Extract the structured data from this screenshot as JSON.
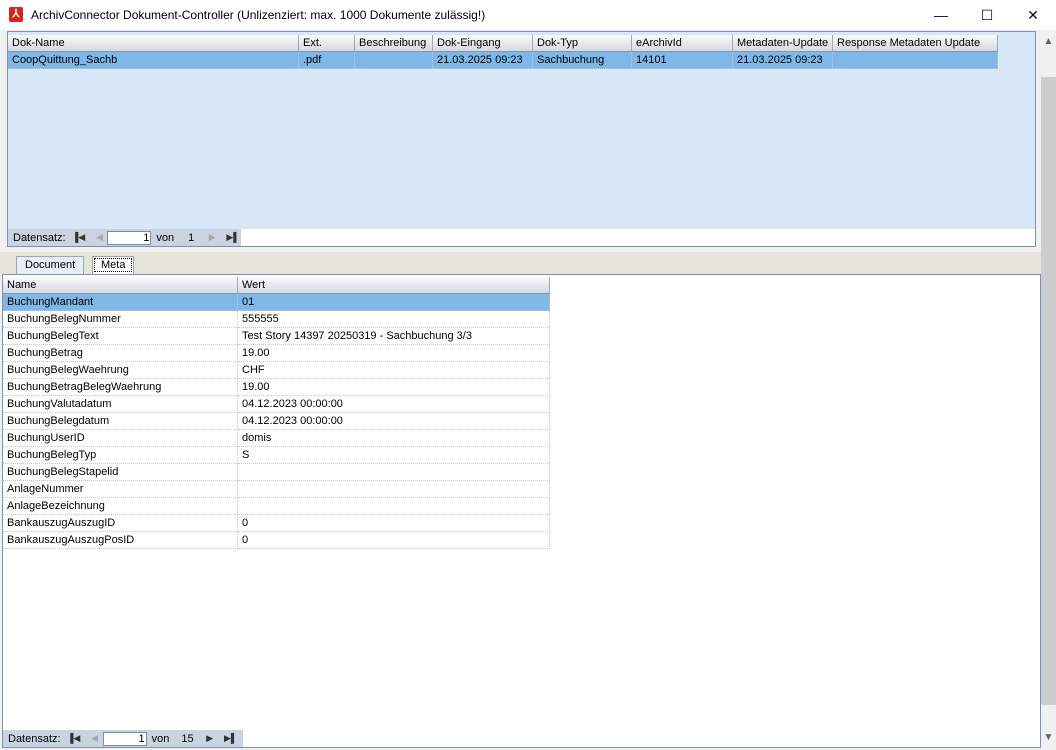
{
  "window": {
    "title": "ArchivConnector Dokument-Controller (Unlizenziert: max. 1000 Dokumente zulässig!)",
    "icon": "pdf-icon",
    "minimize": "—",
    "maximize": "☐",
    "close": "✕"
  },
  "documents": {
    "columns": [
      "Dok-Name",
      "Ext.",
      "Beschreibung",
      "Dok-Eingang",
      "Dok-Typ",
      "eArchivId",
      "Metadaten-Update",
      "Response Metadaten Update"
    ],
    "rows": [
      [
        "CoopQuittung_Sachb",
        ".pdf",
        "",
        "21.03.2025 09:23",
        "Sachbuchung",
        "14101",
        "21.03.2025 09:23",
        ""
      ]
    ],
    "navigator": {
      "label": "Datensatz:",
      "current": "1",
      "of": "von",
      "total": "1"
    }
  },
  "tabs": [
    {
      "label": "Document"
    },
    {
      "label": "Meta"
    }
  ],
  "meta": {
    "columns": [
      "Name",
      "Wert"
    ],
    "rows": [
      [
        "BuchungMandant",
        "01"
      ],
      [
        "BuchungBelegNummer",
        "555555"
      ],
      [
        "BuchungBelegText",
        "Test Story 14397 20250319 - Sachbuchung 3/3"
      ],
      [
        "BuchungBetrag",
        "19.00"
      ],
      [
        "BuchungBelegWaehrung",
        "CHF"
      ],
      [
        "BuchungBetragBelegWaehrung",
        "19.00"
      ],
      [
        "BuchungValutadatum",
        "04.12.2023 00:00:00"
      ],
      [
        "BuchungBelegdatum",
        "04.12.2023 00:00:00"
      ],
      [
        "BuchungUserID",
        "domis"
      ],
      [
        "BuchungBelegTyp",
        "S"
      ],
      [
        "BuchungBelegStapelid",
        ""
      ],
      [
        "AnlageNummer",
        ""
      ],
      [
        "AnlageBezeichnung",
        ""
      ],
      [
        "BankauszugAuszugID",
        "0"
      ],
      [
        "BankauszugAuszugPosID",
        "0"
      ]
    ],
    "navigator": {
      "label": "Datensatz:",
      "current": "1",
      "of": "von",
      "total": "15"
    }
  },
  "colors": {
    "selection": "#7fb8e8",
    "panel": "#d9e8f9"
  }
}
